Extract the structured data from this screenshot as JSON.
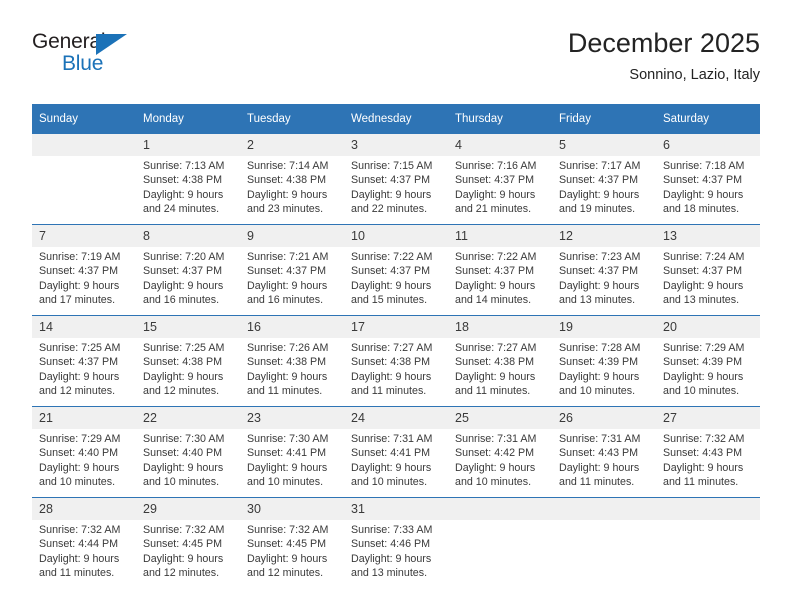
{
  "brand": {
    "name_part1": "General",
    "name_part2": "Blue",
    "triangle_icon": "brand-triangle-icon",
    "accent_color": "#1b72b8"
  },
  "header": {
    "month_title": "December 2025",
    "location": "Sonnino, Lazio, Italy"
  },
  "theme": {
    "header_blue": "#2e74b5",
    "daynum_bg": "#f0f0f0",
    "text": "#3a3a3a"
  },
  "calendar": {
    "weekday_headers": [
      "Sunday",
      "Monday",
      "Tuesday",
      "Wednesday",
      "Thursday",
      "Friday",
      "Saturday"
    ],
    "weeks": [
      [
        {
          "day": "",
          "blank": true,
          "sunrise": "",
          "sunset": "",
          "daylight1": "",
          "daylight2": ""
        },
        {
          "day": "1",
          "blank": false,
          "sunrise": "Sunrise: 7:13 AM",
          "sunset": "Sunset: 4:38 PM",
          "daylight1": "Daylight: 9 hours",
          "daylight2": "and 24 minutes."
        },
        {
          "day": "2",
          "blank": false,
          "sunrise": "Sunrise: 7:14 AM",
          "sunset": "Sunset: 4:38 PM",
          "daylight1": "Daylight: 9 hours",
          "daylight2": "and 23 minutes."
        },
        {
          "day": "3",
          "blank": false,
          "sunrise": "Sunrise: 7:15 AM",
          "sunset": "Sunset: 4:37 PM",
          "daylight1": "Daylight: 9 hours",
          "daylight2": "and 22 minutes."
        },
        {
          "day": "4",
          "blank": false,
          "sunrise": "Sunrise: 7:16 AM",
          "sunset": "Sunset: 4:37 PM",
          "daylight1": "Daylight: 9 hours",
          "daylight2": "and 21 minutes."
        },
        {
          "day": "5",
          "blank": false,
          "sunrise": "Sunrise: 7:17 AM",
          "sunset": "Sunset: 4:37 PM",
          "daylight1": "Daylight: 9 hours",
          "daylight2": "and 19 minutes."
        },
        {
          "day": "6",
          "blank": false,
          "sunrise": "Sunrise: 7:18 AM",
          "sunset": "Sunset: 4:37 PM",
          "daylight1": "Daylight: 9 hours",
          "daylight2": "and 18 minutes."
        }
      ],
      [
        {
          "day": "7",
          "blank": false,
          "sunrise": "Sunrise: 7:19 AM",
          "sunset": "Sunset: 4:37 PM",
          "daylight1": "Daylight: 9 hours",
          "daylight2": "and 17 minutes."
        },
        {
          "day": "8",
          "blank": false,
          "sunrise": "Sunrise: 7:20 AM",
          "sunset": "Sunset: 4:37 PM",
          "daylight1": "Daylight: 9 hours",
          "daylight2": "and 16 minutes."
        },
        {
          "day": "9",
          "blank": false,
          "sunrise": "Sunrise: 7:21 AM",
          "sunset": "Sunset: 4:37 PM",
          "daylight1": "Daylight: 9 hours",
          "daylight2": "and 16 minutes."
        },
        {
          "day": "10",
          "blank": false,
          "sunrise": "Sunrise: 7:22 AM",
          "sunset": "Sunset: 4:37 PM",
          "daylight1": "Daylight: 9 hours",
          "daylight2": "and 15 minutes."
        },
        {
          "day": "11",
          "blank": false,
          "sunrise": "Sunrise: 7:22 AM",
          "sunset": "Sunset: 4:37 PM",
          "daylight1": "Daylight: 9 hours",
          "daylight2": "and 14 minutes."
        },
        {
          "day": "12",
          "blank": false,
          "sunrise": "Sunrise: 7:23 AM",
          "sunset": "Sunset: 4:37 PM",
          "daylight1": "Daylight: 9 hours",
          "daylight2": "and 13 minutes."
        },
        {
          "day": "13",
          "blank": false,
          "sunrise": "Sunrise: 7:24 AM",
          "sunset": "Sunset: 4:37 PM",
          "daylight1": "Daylight: 9 hours",
          "daylight2": "and 13 minutes."
        }
      ],
      [
        {
          "day": "14",
          "blank": false,
          "sunrise": "Sunrise: 7:25 AM",
          "sunset": "Sunset: 4:37 PM",
          "daylight1": "Daylight: 9 hours",
          "daylight2": "and 12 minutes."
        },
        {
          "day": "15",
          "blank": false,
          "sunrise": "Sunrise: 7:25 AM",
          "sunset": "Sunset: 4:38 PM",
          "daylight1": "Daylight: 9 hours",
          "daylight2": "and 12 minutes."
        },
        {
          "day": "16",
          "blank": false,
          "sunrise": "Sunrise: 7:26 AM",
          "sunset": "Sunset: 4:38 PM",
          "daylight1": "Daylight: 9 hours",
          "daylight2": "and 11 minutes."
        },
        {
          "day": "17",
          "blank": false,
          "sunrise": "Sunrise: 7:27 AM",
          "sunset": "Sunset: 4:38 PM",
          "daylight1": "Daylight: 9 hours",
          "daylight2": "and 11 minutes."
        },
        {
          "day": "18",
          "blank": false,
          "sunrise": "Sunrise: 7:27 AM",
          "sunset": "Sunset: 4:38 PM",
          "daylight1": "Daylight: 9 hours",
          "daylight2": "and 11 minutes."
        },
        {
          "day": "19",
          "blank": false,
          "sunrise": "Sunrise: 7:28 AM",
          "sunset": "Sunset: 4:39 PM",
          "daylight1": "Daylight: 9 hours",
          "daylight2": "and 10 minutes."
        },
        {
          "day": "20",
          "blank": false,
          "sunrise": "Sunrise: 7:29 AM",
          "sunset": "Sunset: 4:39 PM",
          "daylight1": "Daylight: 9 hours",
          "daylight2": "and 10 minutes."
        }
      ],
      [
        {
          "day": "21",
          "blank": false,
          "sunrise": "Sunrise: 7:29 AM",
          "sunset": "Sunset: 4:40 PM",
          "daylight1": "Daylight: 9 hours",
          "daylight2": "and 10 minutes."
        },
        {
          "day": "22",
          "blank": false,
          "sunrise": "Sunrise: 7:30 AM",
          "sunset": "Sunset: 4:40 PM",
          "daylight1": "Daylight: 9 hours",
          "daylight2": "and 10 minutes."
        },
        {
          "day": "23",
          "blank": false,
          "sunrise": "Sunrise: 7:30 AM",
          "sunset": "Sunset: 4:41 PM",
          "daylight1": "Daylight: 9 hours",
          "daylight2": "and 10 minutes."
        },
        {
          "day": "24",
          "blank": false,
          "sunrise": "Sunrise: 7:31 AM",
          "sunset": "Sunset: 4:41 PM",
          "daylight1": "Daylight: 9 hours",
          "daylight2": "and 10 minutes."
        },
        {
          "day": "25",
          "blank": false,
          "sunrise": "Sunrise: 7:31 AM",
          "sunset": "Sunset: 4:42 PM",
          "daylight1": "Daylight: 9 hours",
          "daylight2": "and 10 minutes."
        },
        {
          "day": "26",
          "blank": false,
          "sunrise": "Sunrise: 7:31 AM",
          "sunset": "Sunset: 4:43 PM",
          "daylight1": "Daylight: 9 hours",
          "daylight2": "and 11 minutes."
        },
        {
          "day": "27",
          "blank": false,
          "sunrise": "Sunrise: 7:32 AM",
          "sunset": "Sunset: 4:43 PM",
          "daylight1": "Daylight: 9 hours",
          "daylight2": "and 11 minutes."
        }
      ],
      [
        {
          "day": "28",
          "blank": false,
          "sunrise": "Sunrise: 7:32 AM",
          "sunset": "Sunset: 4:44 PM",
          "daylight1": "Daylight: 9 hours",
          "daylight2": "and 11 minutes."
        },
        {
          "day": "29",
          "blank": false,
          "sunrise": "Sunrise: 7:32 AM",
          "sunset": "Sunset: 4:45 PM",
          "daylight1": "Daylight: 9 hours",
          "daylight2": "and 12 minutes."
        },
        {
          "day": "30",
          "blank": false,
          "sunrise": "Sunrise: 7:32 AM",
          "sunset": "Sunset: 4:45 PM",
          "daylight1": "Daylight: 9 hours",
          "daylight2": "and 12 minutes."
        },
        {
          "day": "31",
          "blank": false,
          "sunrise": "Sunrise: 7:33 AM",
          "sunset": "Sunset: 4:46 PM",
          "daylight1": "Daylight: 9 hours",
          "daylight2": "and 13 minutes."
        },
        {
          "day": "",
          "blank": true,
          "sunrise": "",
          "sunset": "",
          "daylight1": "",
          "daylight2": ""
        },
        {
          "day": "",
          "blank": true,
          "sunrise": "",
          "sunset": "",
          "daylight1": "",
          "daylight2": ""
        },
        {
          "day": "",
          "blank": true,
          "sunrise": "",
          "sunset": "",
          "daylight1": "",
          "daylight2": ""
        }
      ]
    ]
  }
}
